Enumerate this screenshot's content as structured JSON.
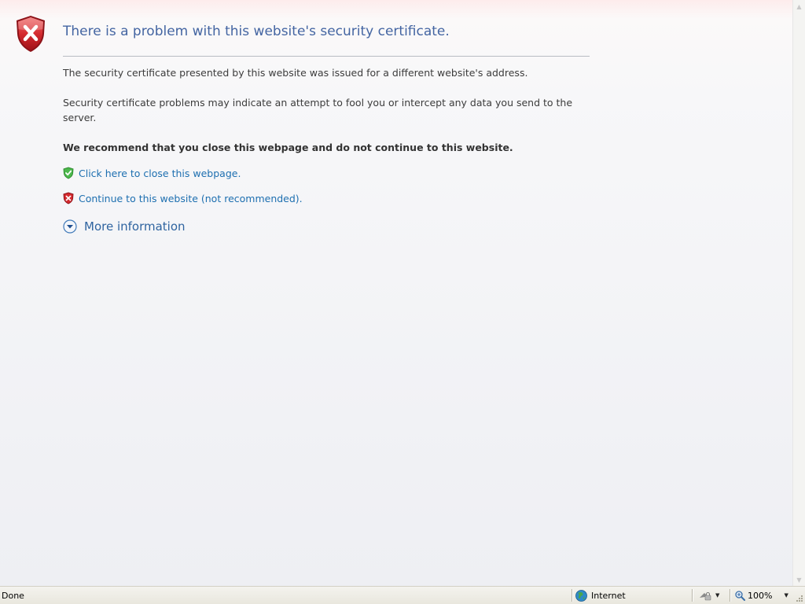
{
  "page": {
    "title": "There is a problem with this website's security certificate.",
    "paragraph1": "The security certificate presented by this website was issued for a different website's address.",
    "paragraph2": "Security certificate problems may indicate an attempt to fool you or intercept any data you send to the server.",
    "recommendation": "We recommend that you close this webpage and do not continue to this website.",
    "close_link": "Click here to close this webpage.",
    "continue_link": "Continue to this website (not recommended).",
    "more_info": "More information"
  },
  "statusbar": {
    "status": "Done",
    "zone": "Internet",
    "zoom": "100%"
  },
  "icons": {
    "error_shield": "shield-x-icon",
    "safe_shield": "shield-check-icon",
    "danger_shield": "shield-x-small-icon",
    "expand": "chevron-down-circle-icon",
    "zone": "globe-icon",
    "zoom": "magnifier-icon"
  },
  "colors": {
    "title": "#4465a2",
    "link": "#1d6fb0",
    "error_red": "#c8242b",
    "safe_green": "#3a9a3a"
  }
}
